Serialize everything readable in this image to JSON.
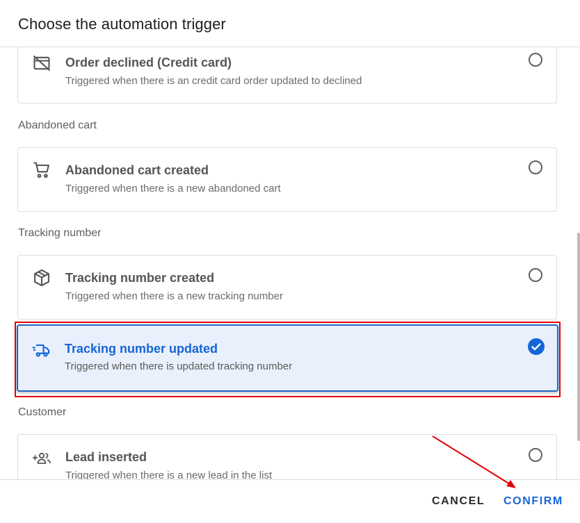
{
  "dialog": {
    "title": "Choose the automation trigger"
  },
  "sections": {
    "abandoned_cart": "Abandoned cart",
    "tracking_number": "Tracking number",
    "customer": "Customer"
  },
  "options": [
    {
      "title": "Order declined (Credit card)",
      "description": "Triggered when there is an credit card order updated to declined",
      "icon": "card-off-icon",
      "selected": false
    },
    {
      "title": "Abandoned cart created",
      "description": "Triggered when there is a new abandoned cart",
      "icon": "cart-icon",
      "selected": false
    },
    {
      "title": "Tracking number created",
      "description": "Triggered when there is a new tracking number",
      "icon": "package-icon",
      "selected": false
    },
    {
      "title": "Tracking number updated",
      "description": "Triggered when there is updated tracking number",
      "icon": "truck-icon",
      "selected": true
    },
    {
      "title": "Lead inserted",
      "description": "Triggered when there is a new lead in the list",
      "icon": "add-people-icon",
      "selected": false
    }
  ],
  "footer": {
    "cancel_label": "CANCEL",
    "confirm_label": "CONFIRM"
  },
  "colors": {
    "accent": "#1565d8",
    "selected_bg": "#e9f0fb",
    "highlight_annotation": "#e00000"
  }
}
